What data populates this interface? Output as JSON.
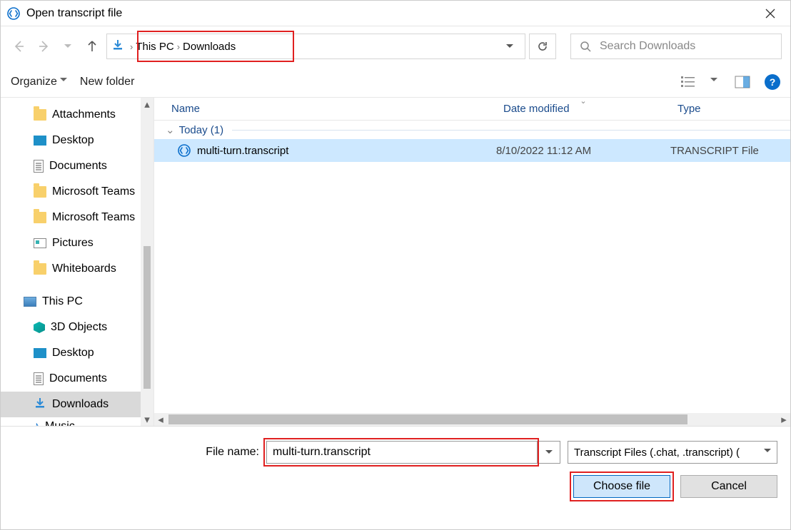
{
  "window": {
    "title": "Open transcript file"
  },
  "nav": {
    "breadcrumb": [
      "This PC",
      "Downloads"
    ],
    "search_placeholder": "Search Downloads"
  },
  "toolbar": {
    "organize": "Organize",
    "new_folder": "New folder"
  },
  "tree": {
    "items": [
      {
        "label": "Attachments",
        "icon": "folder",
        "level": 1
      },
      {
        "label": "Desktop",
        "icon": "desktop",
        "level": 1
      },
      {
        "label": "Documents",
        "icon": "document",
        "level": 1
      },
      {
        "label": "Microsoft Teams",
        "icon": "folder",
        "level": 1
      },
      {
        "label": "Microsoft Teams",
        "icon": "folder",
        "level": 1
      },
      {
        "label": "Pictures",
        "icon": "picture",
        "level": 1
      },
      {
        "label": "Whiteboards",
        "icon": "folder",
        "level": 1
      },
      {
        "label": "This PC",
        "icon": "pc",
        "level": 0
      },
      {
        "label": "3D Objects",
        "icon": "cube",
        "level": 1
      },
      {
        "label": "Desktop",
        "icon": "desktop",
        "level": 1
      },
      {
        "label": "Documents",
        "icon": "document",
        "level": 1
      },
      {
        "label": "Downloads",
        "icon": "download",
        "level": 1,
        "selected": true
      },
      {
        "label": "Music",
        "icon": "music",
        "level": 1,
        "cut": true
      }
    ]
  },
  "list": {
    "columns": {
      "name": "Name",
      "date": "Date modified",
      "type": "Type"
    },
    "group": "Today (1)",
    "rows": [
      {
        "name": "multi-turn.transcript",
        "date": "8/10/2022 11:12 AM",
        "type": "TRANSCRIPT File"
      }
    ]
  },
  "footer": {
    "filename_label": "File name:",
    "filename_value": "multi-turn.transcript",
    "filter_label": "Transcript Files (.chat, .transcript) (",
    "choose": "Choose file",
    "cancel": "Cancel"
  }
}
